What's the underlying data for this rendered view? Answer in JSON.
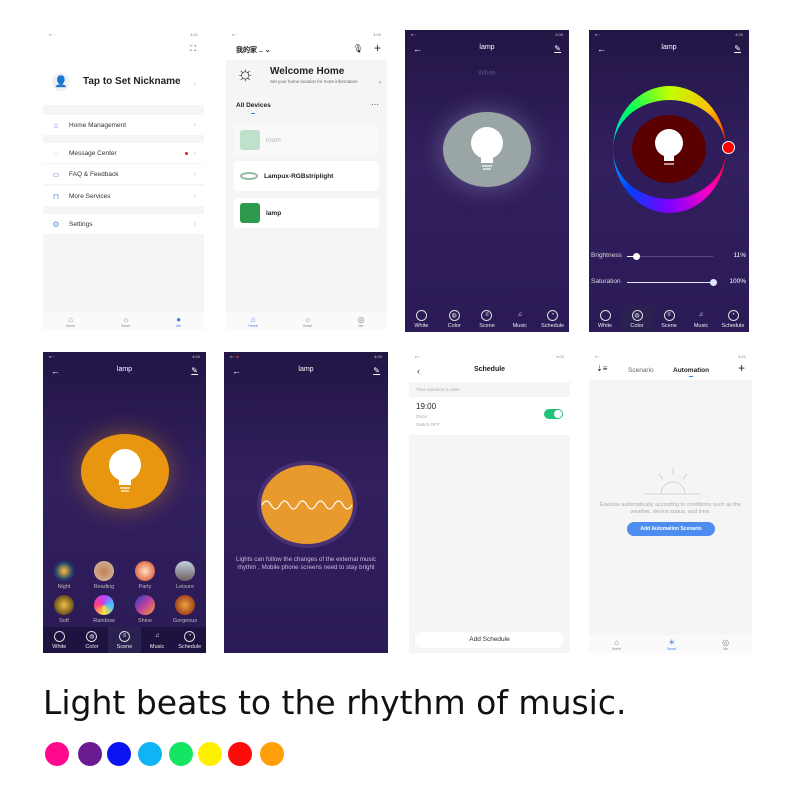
{
  "screens": {
    "me": {
      "time": "4:01",
      "nickname": "Tap to Set Nickname",
      "menu": [
        "Home Management",
        "Message Center",
        "FAQ & Feedback",
        "More Services",
        "Settings"
      ],
      "nav": [
        "Home",
        "Smart",
        "Me"
      ]
    },
    "home": {
      "time": "4:00",
      "home_name": "我的家 ..",
      "welcome": "Welcome Home",
      "welcome_sub": "Set your home location for more information",
      "all_devices": "All Devices",
      "more": "···",
      "devices": [
        "room",
        "Lampux-RGBstriplight",
        "lamp"
      ],
      "nav": [
        "Home",
        "Smart",
        "Me"
      ]
    },
    "white": {
      "time": "4:00",
      "title": "lamp",
      "mode_label": "White",
      "tabs": [
        "White",
        "Color",
        "Scene",
        "Music",
        "Schedule"
      ]
    },
    "color": {
      "time": "4:00",
      "title": "lamp",
      "brightness_label": "Brightness",
      "brightness_value": "11%",
      "brightness": 11,
      "saturation_label": "Saturation",
      "saturation_value": "100%",
      "saturation": 100,
      "selected_color": "#ff0000",
      "tabs": [
        "White",
        "Color",
        "Scene",
        "Music",
        "Schedule"
      ]
    },
    "scene": {
      "time": "4:00",
      "title": "lamp",
      "scenes": [
        "Night",
        "Reading",
        "Party",
        "Leisure",
        "Soft",
        "Rainbow",
        "Shine",
        "Gorgeous"
      ],
      "tabs": [
        "White",
        "Color",
        "Scene",
        "Music",
        "Schedule"
      ],
      "light_color": "#e8960f"
    },
    "music": {
      "time": "4:00",
      "title": "lamp",
      "description": "Lights can follow the changes of the external music rhythm ,  Mobile phone screens need to stay bright"
    },
    "schedule": {
      "time": "4:00",
      "title": "Schedule",
      "variance": "Time variance is ±30s",
      "item": {
        "time": "19:00",
        "repeat": "Once",
        "action": "Switch OFF",
        "enabled": true
      },
      "add_button": "Add Schedule"
    },
    "smart": {
      "time": "4:01",
      "tabs": [
        "Scenario",
        "Automation"
      ],
      "empty_text": "Execute automatically according to conditions such as the weather, device status, and time.",
      "add_button": "Add Automation Scenario",
      "nav": [
        "Home",
        "Smart",
        "Me"
      ]
    }
  },
  "caption": "Light beats to the rhythm of music.",
  "color_swatches": [
    "#ff0a8c",
    "#6a1b8f",
    "#0a14f0",
    "#10b4f5",
    "#14e664",
    "#fff000",
    "#ff0a0a",
    "#ffa00a"
  ]
}
